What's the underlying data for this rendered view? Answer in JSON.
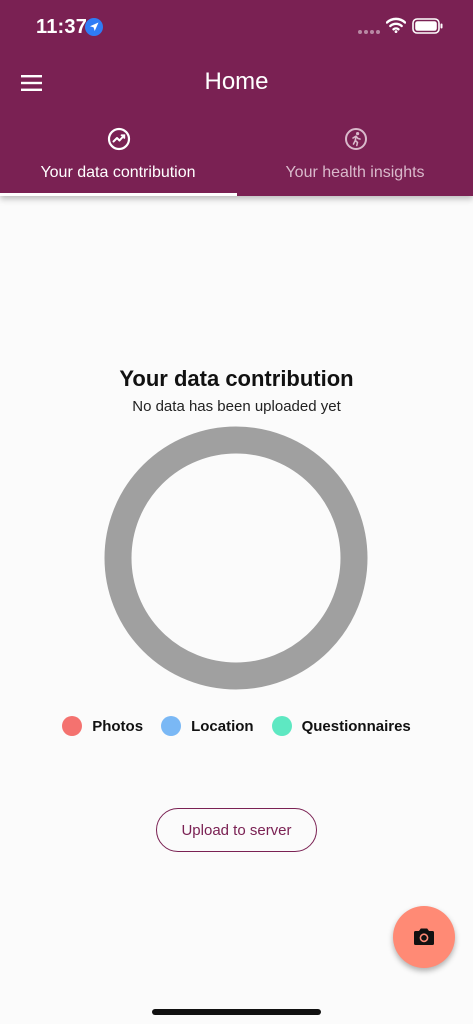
{
  "status_bar": {
    "time": "11:37"
  },
  "app_bar": {
    "title": "Home"
  },
  "tabs": [
    {
      "label": "Your data contribution",
      "icon": "chart-circle-icon",
      "selected": true
    },
    {
      "label": "Your health insights",
      "icon": "running-icon",
      "selected": false
    }
  ],
  "content": {
    "title": "Your data contribution",
    "subtitle": "No data has been uploaded yet"
  },
  "chart_data": {
    "type": "pie",
    "categories": [
      "Photos",
      "Location",
      "Questionnaires"
    ],
    "values": [
      0,
      0,
      0
    ],
    "colors": [
      "#f4726f",
      "#7ab8f5",
      "#5ee8c2"
    ],
    "empty_ring_color": "#a0a0a0",
    "title": "Your data contribution",
    "legend": "bottom"
  },
  "legend": [
    {
      "label": "Photos",
      "color": "#f4726f"
    },
    {
      "label": "Location",
      "color": "#7ab8f5"
    },
    {
      "label": "Questionnaires",
      "color": "#5ee8c2"
    }
  ],
  "actions": {
    "upload_label": "Upload to server"
  },
  "colors": {
    "primary": "#7a2153",
    "fab": "#ff8a75",
    "background": "#fbfbfb"
  }
}
